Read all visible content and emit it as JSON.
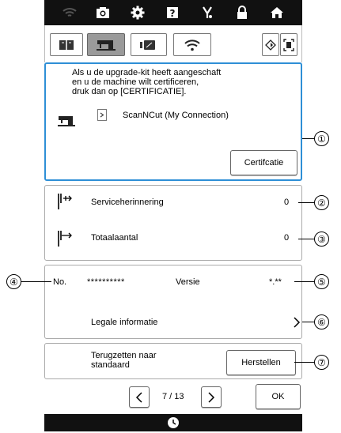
{
  "tabs": [
    {
      "icon": "book-icon"
    },
    {
      "icon": "machine-icon"
    },
    {
      "icon": "screen-icon"
    },
    {
      "icon": "wifi-icon"
    }
  ],
  "certify": {
    "message_line1": "Als u de upgrade-kit heeft aangeschaft",
    "message_line2": "en u de machine wilt certificeren,",
    "message_line3": "druk dan op [CERTIFICATIE].",
    "item_label": "ScanNCut (My Connection)",
    "button_label": "Certifcatie"
  },
  "service": {
    "reminder_label": "Serviceherinnering",
    "reminder_value": "0",
    "total_label": "Totaalaantal",
    "total_value": "0"
  },
  "info": {
    "no_label": "No.",
    "no_value": "**********",
    "version_label": "Versie",
    "version_value": "*.**",
    "legal_label": "Legale informatie"
  },
  "reset": {
    "label_line1": "Terugzetten naar",
    "label_line2": "standaard",
    "button_label": "Herstellen"
  },
  "pager": {
    "page": "7 / 13",
    "ok_label": "OK"
  },
  "callouts": [
    "①",
    "②",
    "③",
    "④",
    "⑤",
    "⑥",
    "⑦"
  ]
}
